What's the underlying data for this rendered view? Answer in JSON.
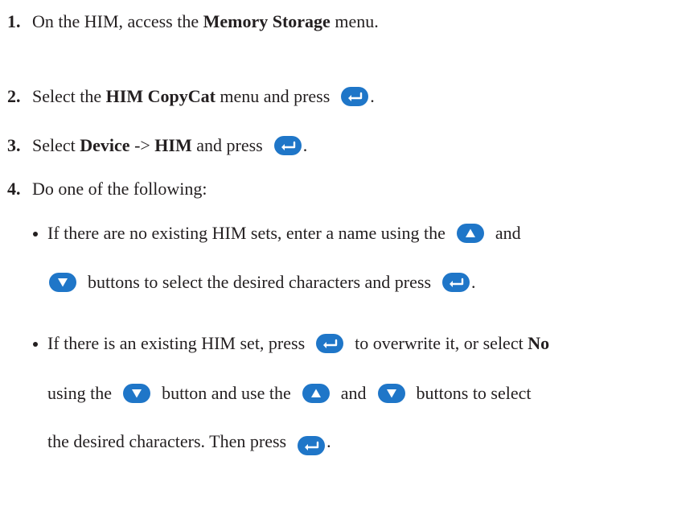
{
  "steps": [
    {
      "number": "1.",
      "text_a": "On the HIM, access the ",
      "bold_a": "Memory Storage",
      "text_b": " menu."
    },
    {
      "number": "2.",
      "text_a": "Select the ",
      "bold_a": "HIM CopyCat",
      "text_b": " menu and press",
      "end": "."
    },
    {
      "number": "3.",
      "text_a": "Select ",
      "bold_a": "Device",
      "text_b": " -> ",
      "bold_b": "HIM",
      "text_c": " and press",
      "end": "."
    },
    {
      "number": "4.",
      "text_a": "Do one of the following:"
    }
  ],
  "bullets": [
    {
      "line1_a": "If there are no existing HIM sets, enter a name using the",
      "line1_b": "and",
      "line2_a": "buttons to select the desired characters and press",
      "line2_end": "."
    },
    {
      "line1_a": "If there is an existing HIM set, press",
      "line1_b": "to overwrite it, or select ",
      "line1_bold": "No",
      "line2_a": "using the",
      "line2_b": "button and use the",
      "line2_c": "and",
      "line2_d": "buttons to select",
      "line3_a": "the desired characters. Then press",
      "line3_end": "."
    }
  ],
  "icons": {
    "enter": "enter-arrow-icon",
    "up": "up-triangle-icon",
    "down": "down-triangle-icon"
  },
  "colors": {
    "button_blue": "#1f76c8",
    "text": "#231f20"
  }
}
